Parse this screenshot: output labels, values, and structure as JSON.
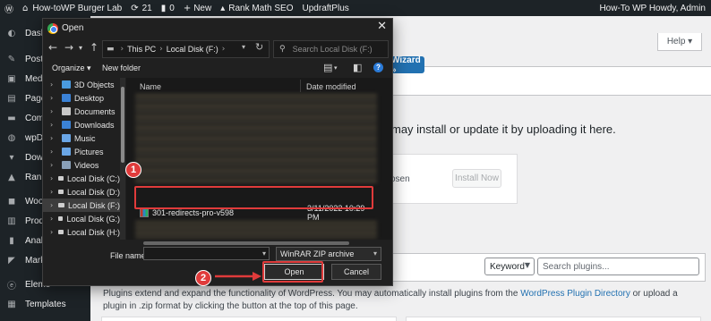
{
  "admin_bar": {
    "wp_logo_icon": "wordpress-icon",
    "site_name": "How-toWP Burger Lab",
    "updates_count": "21",
    "comments_count": "0",
    "new_label": "New",
    "rank_math_label": "Rank Math SEO",
    "updraft_label": "UpdraftPlus",
    "howdy": "How-To WP Howdy, Admin"
  },
  "sidebar": {
    "items": [
      {
        "label": "Dashb",
        "icon": "dashboard-icon"
      },
      {
        "label": "Posts",
        "icon": "pin-icon"
      },
      {
        "label": "Media",
        "icon": "media-icon"
      },
      {
        "label": "Pages",
        "icon": "page-icon"
      },
      {
        "label": "Comm",
        "icon": "comment-icon"
      },
      {
        "label": "wpDis",
        "icon": "discussion-icon"
      },
      {
        "label": "Down",
        "icon": "download-icon"
      },
      {
        "label": "Rank",
        "icon": "rank-icon"
      },
      {
        "label": "WooC",
        "icon": "woo-icon"
      },
      {
        "label": "Produ",
        "icon": "product-icon"
      },
      {
        "label": "Analy",
        "icon": "analytics-icon"
      },
      {
        "label": "Marke",
        "icon": "marketing-icon"
      },
      {
        "label": "Eleme",
        "icon": "elementor-icon"
      },
      {
        "label": "Templates",
        "icon": "templates-icon"
      }
    ]
  },
  "content": {
    "help_label": "Help ▾",
    "wizard_label": "Wizard »",
    "upload_text": "may install or update it by uploading it here.",
    "chosen_text": "osen",
    "install_now": "Install Now",
    "keyword_label": "Keyword",
    "search_placeholder": "Search plugins...",
    "plugins_desc_1": "Plugins extend and expand the functionality of WordPress. You may automatically install plugins from the ",
    "plugins_desc_link": "WordPress Plugin Directory",
    "plugins_desc_2": " or upload a plugin in .zip format by clicking the button at the top of this page."
  },
  "dialog": {
    "title": "Open",
    "close": "✕",
    "breadcrumb": [
      "This PC",
      "Local Disk (F:)"
    ],
    "search_placeholder": "Search Local Disk (F:)",
    "organize": "Organize ▾",
    "new_folder": "New folder",
    "nav_items": [
      {
        "label": "3D Objects",
        "color": "#4a9be0"
      },
      {
        "label": "Desktop",
        "color": "#3b82d6"
      },
      {
        "label": "Documents",
        "color": "#c8c8c8"
      },
      {
        "label": "Downloads",
        "color": "#3b82d6"
      },
      {
        "label": "Music",
        "color": "#6aa6e6"
      },
      {
        "label": "Pictures",
        "color": "#6aa6e6"
      },
      {
        "label": "Videos",
        "color": "#8aa0b8"
      },
      {
        "label": "Local Disk (C:)",
        "color": "#cfcfcf"
      },
      {
        "label": "Local Disk (D:)",
        "color": "#cfcfcf"
      },
      {
        "label": "Local Disk (F:)",
        "color": "#cfcfcf",
        "selected": true
      },
      {
        "label": "Local Disk (G:)",
        "color": "#cfcfcf"
      },
      {
        "label": "Local Disk (H:)",
        "color": "#cfcfcf"
      }
    ],
    "columns": {
      "name": "Name",
      "date": "Date modified"
    },
    "file": {
      "name": "301-redirects-pro-v598",
      "date": "3/11/2022 10:29 PM"
    },
    "file_name_label": "File name:",
    "file_name_value": "",
    "file_type": "WinRAR ZIP archive",
    "open_label": "Open",
    "cancel_label": "Cancel"
  },
  "annotations": {
    "step1": "1",
    "step2": "2",
    "accent": "#e03b3b"
  }
}
